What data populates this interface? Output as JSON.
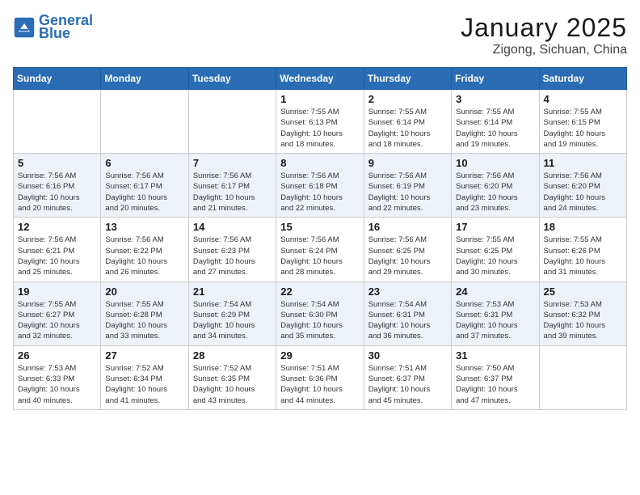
{
  "header": {
    "logo_line1": "General",
    "logo_line2": "Blue",
    "month_title": "January 2025",
    "location": "Zigong, Sichuan, China"
  },
  "days_of_week": [
    "Sunday",
    "Monday",
    "Tuesday",
    "Wednesday",
    "Thursday",
    "Friday",
    "Saturday"
  ],
  "weeks": [
    {
      "days": [
        {
          "number": "",
          "info": ""
        },
        {
          "number": "",
          "info": ""
        },
        {
          "number": "",
          "info": ""
        },
        {
          "number": "1",
          "info": "Sunrise: 7:55 AM\nSunset: 6:13 PM\nDaylight: 10 hours\nand 18 minutes."
        },
        {
          "number": "2",
          "info": "Sunrise: 7:55 AM\nSunset: 6:14 PM\nDaylight: 10 hours\nand 18 minutes."
        },
        {
          "number": "3",
          "info": "Sunrise: 7:55 AM\nSunset: 6:14 PM\nDaylight: 10 hours\nand 19 minutes."
        },
        {
          "number": "4",
          "info": "Sunrise: 7:55 AM\nSunset: 6:15 PM\nDaylight: 10 hours\nand 19 minutes."
        }
      ]
    },
    {
      "days": [
        {
          "number": "5",
          "info": "Sunrise: 7:56 AM\nSunset: 6:16 PM\nDaylight: 10 hours\nand 20 minutes."
        },
        {
          "number": "6",
          "info": "Sunrise: 7:56 AM\nSunset: 6:17 PM\nDaylight: 10 hours\nand 20 minutes."
        },
        {
          "number": "7",
          "info": "Sunrise: 7:56 AM\nSunset: 6:17 PM\nDaylight: 10 hours\nand 21 minutes."
        },
        {
          "number": "8",
          "info": "Sunrise: 7:56 AM\nSunset: 6:18 PM\nDaylight: 10 hours\nand 22 minutes."
        },
        {
          "number": "9",
          "info": "Sunrise: 7:56 AM\nSunset: 6:19 PM\nDaylight: 10 hours\nand 22 minutes."
        },
        {
          "number": "10",
          "info": "Sunrise: 7:56 AM\nSunset: 6:20 PM\nDaylight: 10 hours\nand 23 minutes."
        },
        {
          "number": "11",
          "info": "Sunrise: 7:56 AM\nSunset: 6:20 PM\nDaylight: 10 hours\nand 24 minutes."
        }
      ]
    },
    {
      "days": [
        {
          "number": "12",
          "info": "Sunrise: 7:56 AM\nSunset: 6:21 PM\nDaylight: 10 hours\nand 25 minutes."
        },
        {
          "number": "13",
          "info": "Sunrise: 7:56 AM\nSunset: 6:22 PM\nDaylight: 10 hours\nand 26 minutes."
        },
        {
          "number": "14",
          "info": "Sunrise: 7:56 AM\nSunset: 6:23 PM\nDaylight: 10 hours\nand 27 minutes."
        },
        {
          "number": "15",
          "info": "Sunrise: 7:56 AM\nSunset: 6:24 PM\nDaylight: 10 hours\nand 28 minutes."
        },
        {
          "number": "16",
          "info": "Sunrise: 7:56 AM\nSunset: 6:25 PM\nDaylight: 10 hours\nand 29 minutes."
        },
        {
          "number": "17",
          "info": "Sunrise: 7:55 AM\nSunset: 6:25 PM\nDaylight: 10 hours\nand 30 minutes."
        },
        {
          "number": "18",
          "info": "Sunrise: 7:55 AM\nSunset: 6:26 PM\nDaylight: 10 hours\nand 31 minutes."
        }
      ]
    },
    {
      "days": [
        {
          "number": "19",
          "info": "Sunrise: 7:55 AM\nSunset: 6:27 PM\nDaylight: 10 hours\nand 32 minutes."
        },
        {
          "number": "20",
          "info": "Sunrise: 7:55 AM\nSunset: 6:28 PM\nDaylight: 10 hours\nand 33 minutes."
        },
        {
          "number": "21",
          "info": "Sunrise: 7:54 AM\nSunset: 6:29 PM\nDaylight: 10 hours\nand 34 minutes."
        },
        {
          "number": "22",
          "info": "Sunrise: 7:54 AM\nSunset: 6:30 PM\nDaylight: 10 hours\nand 35 minutes."
        },
        {
          "number": "23",
          "info": "Sunrise: 7:54 AM\nSunset: 6:31 PM\nDaylight: 10 hours\nand 36 minutes."
        },
        {
          "number": "24",
          "info": "Sunrise: 7:53 AM\nSunset: 6:31 PM\nDaylight: 10 hours\nand 37 minutes."
        },
        {
          "number": "25",
          "info": "Sunrise: 7:53 AM\nSunset: 6:32 PM\nDaylight: 10 hours\nand 39 minutes."
        }
      ]
    },
    {
      "days": [
        {
          "number": "26",
          "info": "Sunrise: 7:53 AM\nSunset: 6:33 PM\nDaylight: 10 hours\nand 40 minutes."
        },
        {
          "number": "27",
          "info": "Sunrise: 7:52 AM\nSunset: 6:34 PM\nDaylight: 10 hours\nand 41 minutes."
        },
        {
          "number": "28",
          "info": "Sunrise: 7:52 AM\nSunset: 6:35 PM\nDaylight: 10 hours\nand 43 minutes."
        },
        {
          "number": "29",
          "info": "Sunrise: 7:51 AM\nSunset: 6:36 PM\nDaylight: 10 hours\nand 44 minutes."
        },
        {
          "number": "30",
          "info": "Sunrise: 7:51 AM\nSunset: 6:37 PM\nDaylight: 10 hours\nand 45 minutes."
        },
        {
          "number": "31",
          "info": "Sunrise: 7:50 AM\nSunset: 6:37 PM\nDaylight: 10 hours\nand 47 minutes."
        },
        {
          "number": "",
          "info": ""
        }
      ]
    }
  ]
}
